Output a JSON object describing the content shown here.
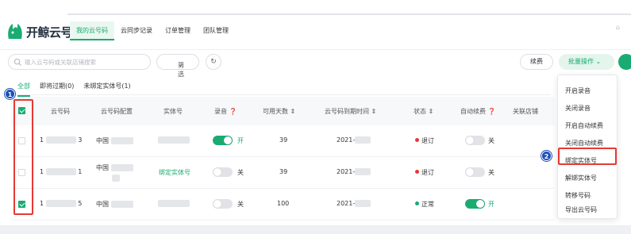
{
  "app": {
    "brand": "开鲸云号"
  },
  "nav": [
    "我的云号码",
    "云同步记录",
    "订单管理",
    "团队管理"
  ],
  "toolbar": {
    "search_placeholder": "输入云号码或关联店铺搜索",
    "filter_label": "筛选",
    "refresh_icon": "refresh-icon",
    "renew_label": "续费",
    "batch_label": "批量操作"
  },
  "tabs": [
    "全部",
    "即将过期(0)",
    "未绑定实体号(1)"
  ],
  "table": {
    "headers": [
      "云号码",
      "云号码配置",
      "实体号",
      "录音",
      "可用天数",
      "云号码到期时间",
      "状态",
      "自动续费",
      "关联店铺"
    ],
    "rows": [
      {
        "checked": false,
        "number_prefix": "1",
        "number_suffix": "3",
        "config": "中国",
        "entity_link": "",
        "recording_on": true,
        "recording_label": "开",
        "days": "39",
        "expiry": "2021-",
        "status": "退订",
        "status_color": "#e53935",
        "auto_renew_on": false,
        "auto_renew_label": "关"
      },
      {
        "checked": false,
        "number_prefix": "1",
        "number_suffix": "1",
        "config": "中国",
        "entity_link": "绑定实体号",
        "recording_on": false,
        "recording_label": "关",
        "days": "39",
        "expiry": "2021-",
        "status": "退订",
        "status_color": "#e53935",
        "auto_renew_on": false,
        "auto_renew_label": "关"
      },
      {
        "checked": true,
        "number_prefix": "1",
        "number_suffix": "5",
        "config": "中国",
        "entity_link": "",
        "recording_on": false,
        "recording_label": "关",
        "days": "100",
        "expiry": "2021-",
        "status": "正常",
        "status_color": "#1aab72",
        "auto_renew_on": true,
        "auto_renew_label": "开"
      }
    ]
  },
  "batch_menu": [
    "开启录音",
    "关闭录音",
    "开启自动续费",
    "关闭自动续费",
    "绑定实体号",
    "解绑实体号",
    "转移号码",
    "导出云号码"
  ],
  "annotations": {
    "badge_1": "1",
    "badge_2": "2"
  },
  "colors": {
    "accent": "#1aab72",
    "highlight": "#e53935",
    "badge": "#1d4fb8"
  }
}
